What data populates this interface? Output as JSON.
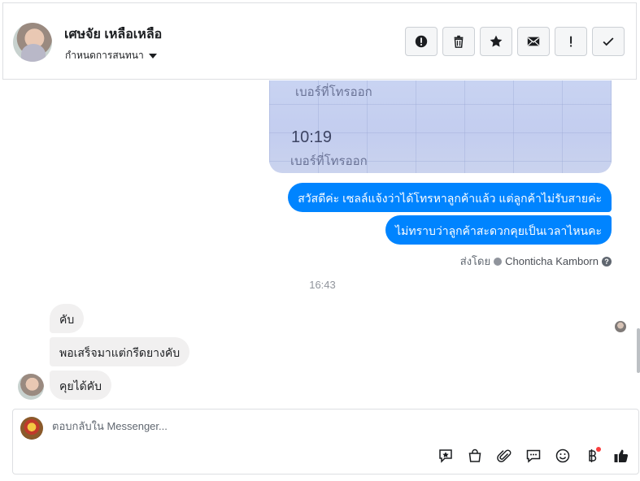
{
  "header": {
    "contact_name": "เศษจัย เหลือเหลือ",
    "convo_menu_label": "กำหนดการสนทนา",
    "toolbar": [
      {
        "name": "spam-button",
        "icon": "alert-circle-icon"
      },
      {
        "name": "delete-button",
        "icon": "trash-icon"
      },
      {
        "name": "star-button",
        "icon": "star-icon"
      },
      {
        "name": "mark-unread-button",
        "icon": "envelope-icon"
      },
      {
        "name": "important-button",
        "icon": "exclamation-icon"
      },
      {
        "name": "done-button",
        "icon": "check-icon"
      }
    ]
  },
  "photo": {
    "line1": "เบอร์ที่โทรออก",
    "time": "10:19",
    "line2": "เบอร์ที่โทรออก"
  },
  "messages_out": [
    "สวัสดีค่ะ เซลล์แจ้งว่าได้โทรหาลูกค้าแล้ว แต่ลูกค้าไม่รับสายค่ะ",
    "ไม่ทราบว่าลูกค้าสะดวกคุยเป็นเวลาไหนคะ"
  ],
  "sent_by": {
    "prefix": "ส่งโดย",
    "agent": "Chonticha Kamborn"
  },
  "timestamp": "16:43",
  "messages_in": [
    "คับ",
    "พอเสร็จมาแต่กรีดยางคับ",
    "คุยได้คับ"
  ],
  "composer": {
    "placeholder": "ตอบกลับใน Messenger...",
    "tools": [
      "saved-reply-icon",
      "shop-bag-icon",
      "attachment-icon",
      "chat-bubble-icon",
      "emoji-icon",
      "baht-icon",
      "like-icon"
    ]
  },
  "colors": {
    "outgoing_bubble": "#0084ff",
    "incoming_bubble": "#f1f0f0",
    "like": "#1c1e21",
    "notification_dot": "#fa3e3e"
  }
}
